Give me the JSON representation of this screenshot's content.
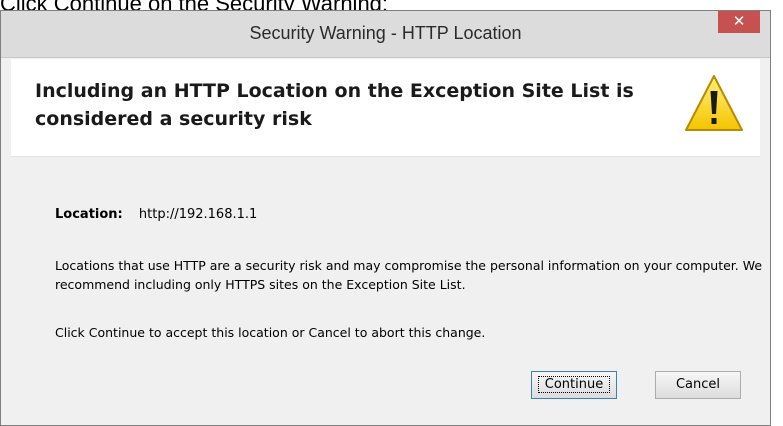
{
  "caption": "Click Continue on the Security Warning:",
  "dialog": {
    "title": "Security Warning - HTTP Location",
    "close_label": "✕",
    "heading": "Including an HTTP Location on the Exception Site List is considered a security risk",
    "warning_icon": "warning-triangle-icon",
    "location_label": "Location:",
    "location_value": "http://192.168.1.1",
    "message": "Locations that use HTTP are a security risk and may compromise the personal information on your computer.  We recommend including only HTTPS sites on the Exception Site List.",
    "instruction": "Click Continue to accept this location or Cancel to abort this change.",
    "buttons": {
      "continue": "Continue",
      "cancel": "Cancel"
    }
  },
  "colors": {
    "close_button": "#c75050",
    "warning_fill": "#ffd82f",
    "warning_stroke": "#b88a00"
  }
}
